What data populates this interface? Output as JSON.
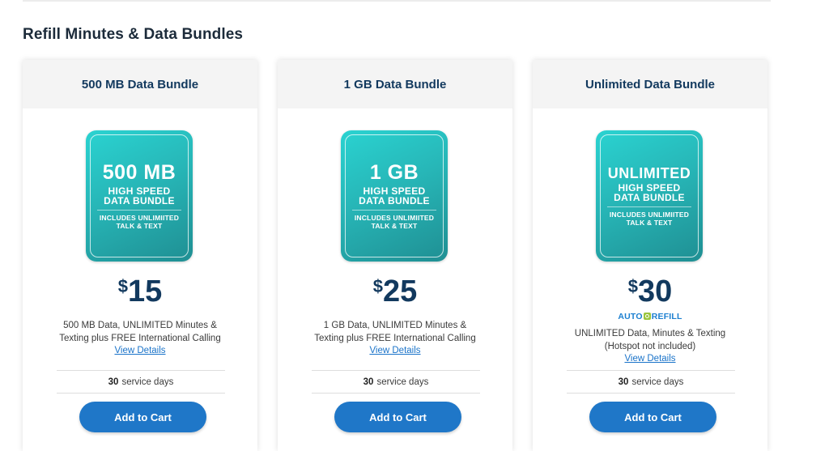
{
  "page": {
    "section_title": "Refill Minutes & Data Bundles"
  },
  "cards": [
    {
      "title": "500 MB Data Bundle",
      "tile_big": "500 MB",
      "tile_sub1": "HIGH SPEED",
      "tile_sub2": "DATA BUNDLE",
      "tile_note1": "INCLUDES UNLIMIITED",
      "tile_note2": "TALK & TEXT",
      "price_symbol": "$",
      "price_value": "15",
      "desc_line1": "500 MB Data, UNLIMITED Minutes &",
      "desc_line2": "Texting plus FREE International Calling",
      "details_link": "View Details",
      "service_days": "30",
      "service_label": "service days",
      "cart_label": "Add to Cart"
    },
    {
      "title": "1 GB Data Bundle",
      "tile_big": "1 GB",
      "tile_sub1": "HIGH SPEED",
      "tile_sub2": "DATA BUNDLE",
      "tile_note1": "INCLUDES UNLIMIITED",
      "tile_note2": "TALK & TEXT",
      "price_symbol": "$",
      "price_value": "25",
      "desc_line1": "1 GB Data, UNLIMITED Minutes &",
      "desc_line2": "Texting plus FREE International Calling",
      "details_link": "View Details",
      "service_days": "30",
      "service_label": "service days",
      "cart_label": "Add to Cart"
    },
    {
      "title": "Unlimited Data Bundle",
      "tile_big": "UNLIMITED",
      "tile_sub1": "HIGH SPEED",
      "tile_sub2": "DATA BUNDLE",
      "tile_note1": "INCLUDES UNLIMIITED",
      "tile_note2": "TALK & TEXT",
      "price_symbol": "$",
      "price_value": "30",
      "autorefill_left": "AUTO",
      "autorefill_right": "REFILL",
      "desc_line1": "UNLIMITED Data, Minutes & Texting",
      "desc_line2": "(Hotspot not included)",
      "details_link": "View Details",
      "service_days": "30",
      "service_label": "service days",
      "cart_label": "Add to Cart"
    }
  ],
  "colors": {
    "heading": "#12395e",
    "button": "#1f77c8",
    "link": "#1a73c9",
    "tile_teal": "#27b6b7",
    "autorefill_icon": "#9bc53d"
  },
  "icons": {
    "autorefill": "refill-icon"
  }
}
